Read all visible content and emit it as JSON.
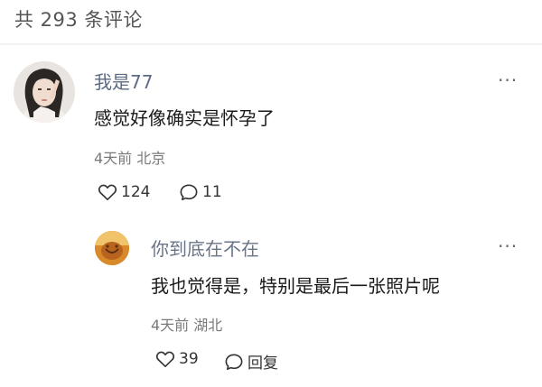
{
  "header": {
    "comment_count": "共 293 条评论"
  },
  "comments": [
    {
      "username": "我是77",
      "text": "感觉好像确实是怀孕了",
      "meta": "4天前 北京",
      "likes": "124",
      "replies": "11",
      "more": "···",
      "avatar": "girl-portrait",
      "replies_list": [
        {
          "username": "你到底在不在",
          "text": "我也觉得是，特别是最后一张照片呢",
          "meta": "4天前 湖北",
          "likes": "39",
          "reply_label": "回复",
          "more": "···",
          "avatar": "sunset-face"
        }
      ]
    }
  ],
  "icons": {
    "like": "heart-outline-icon",
    "comment": "speech-bubble-icon",
    "more": "ellipsis-icon"
  },
  "colors": {
    "username": "#5d6b82",
    "text": "#1a1a1a",
    "meta": "#7a7a7a"
  }
}
